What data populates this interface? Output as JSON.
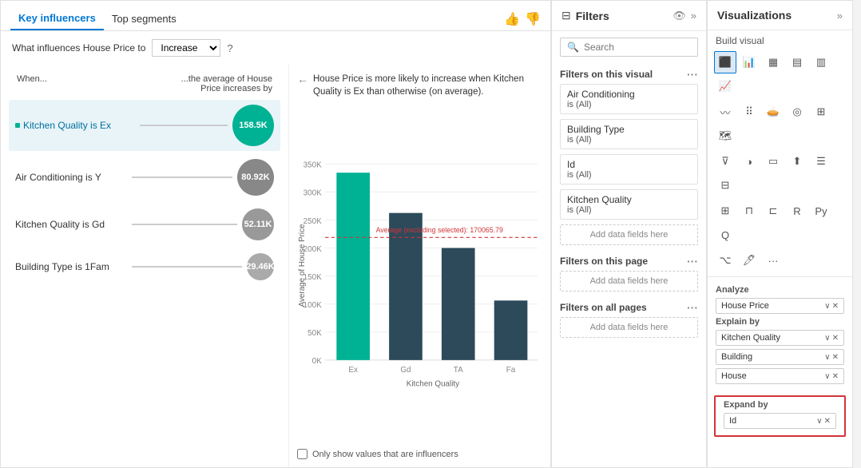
{
  "tabs": {
    "key_influencers": "Key influencers",
    "top_segments": "Top segments"
  },
  "header": {
    "question": "What influences House Price to",
    "dropdown_value": "Increase",
    "help": "?"
  },
  "columns": {
    "left": "When...",
    "right": "...the average of House Price increases by"
  },
  "influencers": [
    {
      "label": "Kitchen Quality is Ex",
      "value": "158.5K",
      "bubble_size": "teal",
      "selected": true
    },
    {
      "label": "Air Conditioning is Y",
      "value": "80.92K",
      "bubble_size": "gray-lg",
      "selected": false
    },
    {
      "label": "Kitchen Quality is Gd",
      "value": "52.11K",
      "bubble_size": "gray-md",
      "selected": false
    },
    {
      "label": "Building Type is 1Fam",
      "value": "29.46K",
      "bubble_size": "gray-sm",
      "selected": false
    }
  ],
  "chart": {
    "description": "House Price is more likely to increase when Kitchen Quality is Ex than otherwise (on average).",
    "avg_line_label": "Average (excluding selected): 170065.79",
    "x_axis_label": "Kitchen Quality",
    "y_axis_label": "Average of House Price",
    "y_ticks": [
      "0K",
      "50K",
      "100K",
      "150K",
      "200K",
      "250K",
      "300K",
      "350K"
    ],
    "x_ticks": [
      "Ex",
      "Gd",
      "TA",
      "Fa"
    ],
    "bars": [
      {
        "label": "Ex",
        "height": 0.92,
        "color": "#00b294"
      },
      {
        "label": "Gd",
        "height": 0.72,
        "color": "#2d4a5a"
      },
      {
        "label": "TA",
        "height": 0.55,
        "color": "#2d4a5a"
      },
      {
        "label": "Fa",
        "height": 0.28,
        "color": "#2d4a5a"
      }
    ],
    "checkbox_label": "Only show values that are influencers"
  },
  "filters": {
    "title": "Filters",
    "search_placeholder": "Search",
    "on_visual": {
      "title": "Filters on this visual",
      "items": [
        {
          "name": "Air Conditioning",
          "value": "is (All)"
        },
        {
          "name": "Building Type",
          "value": "is (All)"
        },
        {
          "name": "Id",
          "value": "is (All)"
        },
        {
          "name": "Kitchen Quality",
          "value": "is (All)"
        }
      ],
      "add_label": "Add data fields here"
    },
    "on_page": {
      "title": "Filters on this page",
      "add_label": "Add data fields here"
    },
    "on_all": {
      "title": "Filters on all pages",
      "add_label": "Add data fields here"
    }
  },
  "visualizations": {
    "title": "Visualizations",
    "build_visual_label": "Build visual",
    "analyze": {
      "label": "Analyze",
      "field": "House Price",
      "chevron": "∨",
      "close": "✕"
    },
    "explain_by": {
      "label": "Explain by",
      "fields": [
        {
          "text": "Kitchen Quality",
          "chevron": "∨",
          "close": "✕"
        },
        {
          "text": "Building",
          "chevron": "∨",
          "close": "✕"
        },
        {
          "text": "House",
          "chevron": "∨",
          "close": "✕"
        }
      ]
    },
    "expand_by": {
      "label": "Expand by",
      "fields": [
        {
          "text": "Id",
          "chevron": "∨",
          "close": "✕"
        }
      ]
    }
  }
}
